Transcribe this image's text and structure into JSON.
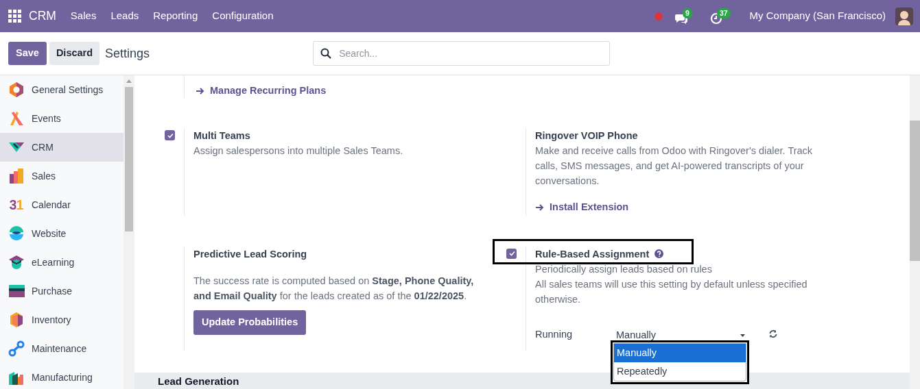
{
  "navbar": {
    "brand": "CRM",
    "menu": [
      "Sales",
      "Leads",
      "Reporting",
      "Configuration"
    ],
    "status_dot": true,
    "indicators": [
      {
        "kind": "chat",
        "count": "9"
      },
      {
        "kind": "activity",
        "count": "37"
      }
    ],
    "company": "My Company (San Francisco)"
  },
  "control_panel": {
    "buttons": [
      {
        "label": "Save",
        "kind": "primary"
      },
      {
        "label": "Discard",
        "kind": "secondary"
      }
    ],
    "title": "Settings",
    "search": {
      "placeholder": "Search..."
    }
  },
  "sidebar": {
    "items": [
      {
        "label": "General Settings",
        "selected": false
      },
      {
        "label": "Events",
        "selected": false
      },
      {
        "label": "CRM",
        "selected": true
      },
      {
        "label": "Sales",
        "selected": false
      },
      {
        "label": "Calendar",
        "selected": false,
        "icon_text": "31"
      },
      {
        "label": "Website",
        "selected": false
      },
      {
        "label": "eLearning",
        "selected": false
      },
      {
        "label": "Purchase",
        "selected": false
      },
      {
        "label": "Inventory",
        "selected": false
      },
      {
        "label": "Maintenance",
        "selected": false
      },
      {
        "label": "Manufacturing",
        "selected": false
      }
    ]
  },
  "settings": {
    "top_link": "Manage Recurring Plans",
    "rows": [
      [
        {
          "kind": "checkbox",
          "checked": true,
          "title": "Multi Teams",
          "description": [
            "Assign salespersons into multiple Sales Teams."
          ]
        },
        {
          "kind": "plain",
          "title": "Ringover VOIP Phone",
          "description": [
            "Make and receive calls from Odoo with Ringover's dialer. Track calls, SMS messages, and get AI-powered transcripts of your conversations."
          ],
          "link": "Install Extension"
        }
      ],
      [
        {
          "kind": "plain",
          "title": "Predictive Lead Scoring",
          "description": [
            "The success rate is computed based on **Stage, Phone Quality, and Email Quality** for the leads created as of the **01/22/2025**."
          ],
          "button": "Update Probabilities"
        },
        {
          "kind": "checkbox",
          "checked": true,
          "title": "Rule-Based Assignment",
          "help": true,
          "highlighted": true,
          "description": [
            "Periodically assign leads based on rules",
            "All sales teams will use this setting by default unless specified otherwise."
          ],
          "field": {
            "label": "Running",
            "value": "Manually",
            "open": true,
            "highlighted": true,
            "options": [
              {
                "label": "Manually",
                "selected": true
              },
              {
                "label": "Repeatedly",
                "selected": false
              }
            ]
          }
        }
      ]
    ]
  },
  "section": {
    "title": "Lead Generation"
  }
}
